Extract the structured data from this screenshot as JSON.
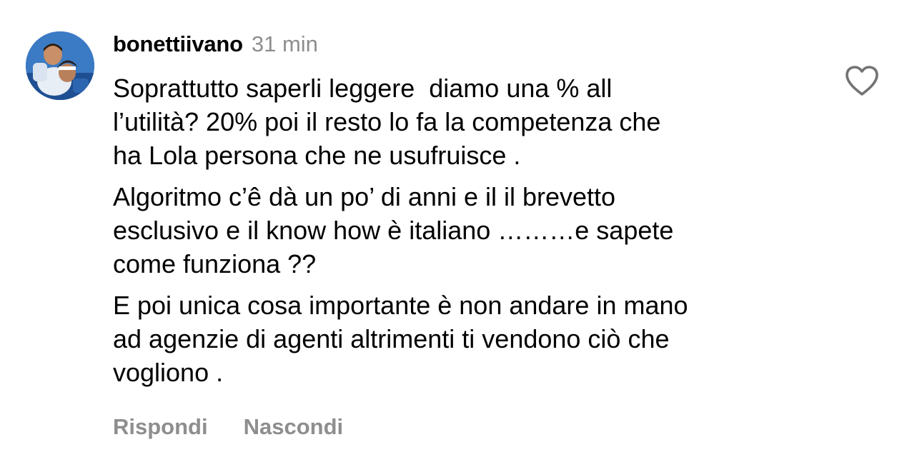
{
  "comment": {
    "username": "bonettiivano",
    "time": "31 min",
    "paragraphs": [
      "Soprattutto saperli leggere  diamo una % all\nl’utilità? 20% poi il resto lo fa la competenza che\nha Lola persona che ne usufruisce .",
      "Algoritmo c’ê dà un po’ di anni e il il brevetto\nesclusivo e il know how è italiano ………e sapete\ncome funziona ??",
      "E poi unica cosa importante è non andare in mano\nad agenzie di agenti altrimenti ti vendono ciò che\nvogliono ."
    ],
    "actions": {
      "reply": "Rispondi",
      "hide": "Nascondi"
    },
    "icons": {
      "like": "heart-outline-icon",
      "avatar": "profile-photo"
    }
  },
  "colors": {
    "text": "#000000",
    "secondary": "#8e8e8e",
    "background": "#ffffff"
  }
}
